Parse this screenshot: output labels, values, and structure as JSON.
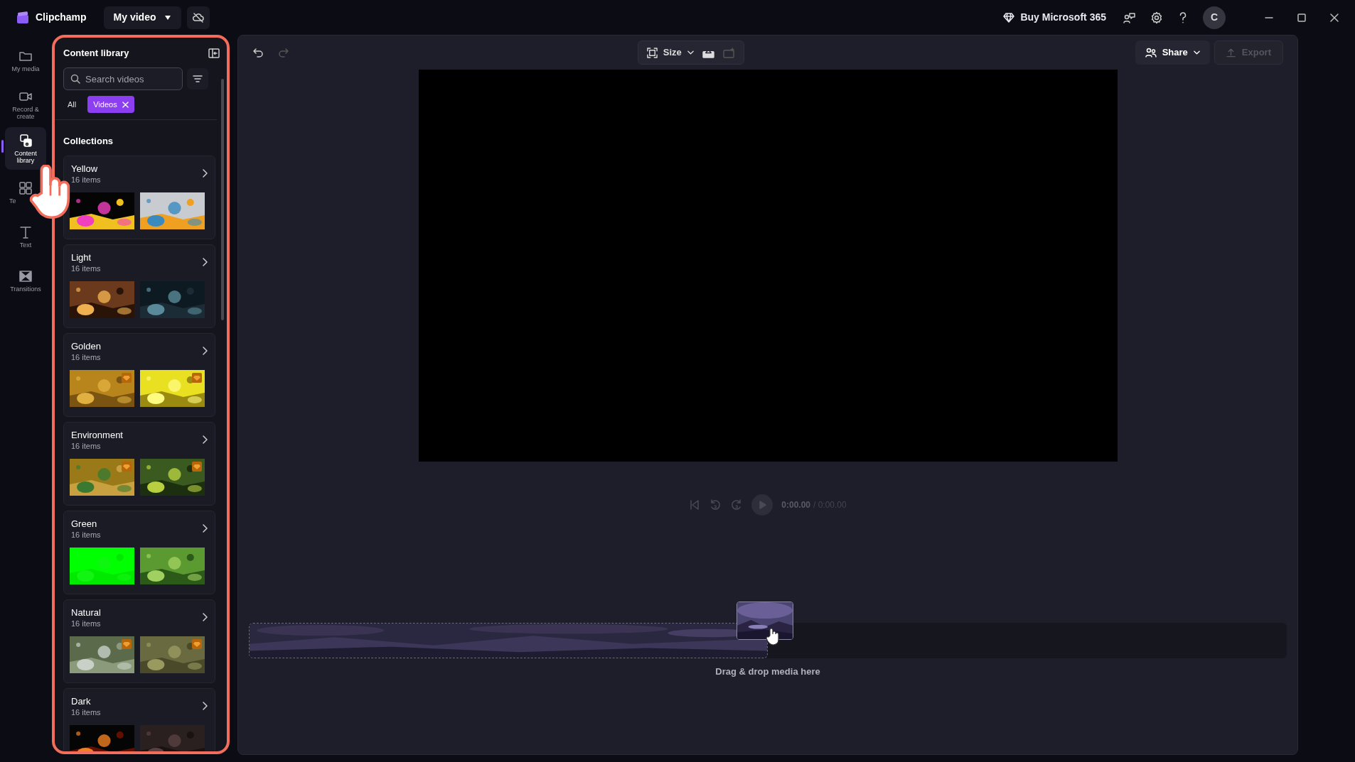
{
  "app": {
    "name": "Clipchamp"
  },
  "project": {
    "title": "My video"
  },
  "top_bar": {
    "promo": "Buy Microsoft 365",
    "avatar": "C"
  },
  "nav": [
    {
      "label": "My media",
      "kind": "folder",
      "selected": false
    },
    {
      "label": "Record & create",
      "kind": "camera",
      "selected": false
    },
    {
      "label": "Content library",
      "kind": "library",
      "selected": true
    },
    {
      "label": "Te",
      "kind": "templates",
      "selected": false
    },
    {
      "label": "Text",
      "kind": "text",
      "selected": false
    },
    {
      "label": "Transitions",
      "kind": "transitions",
      "selected": false
    }
  ],
  "panel": {
    "title": "Content library",
    "search": {
      "placeholder": "Search videos"
    },
    "filters": [
      {
        "label": "All",
        "selected": false
      },
      {
        "label": "Videos",
        "selected": true
      }
    ],
    "section": "Collections",
    "collections": [
      {
        "name": "Yellow",
        "count": "16 items",
        "thumbnails": [
          {
            "kind": "picture",
            "premium": false
          },
          {
            "kind": "picture",
            "premium": false
          }
        ]
      },
      {
        "name": "Light",
        "count": "16 items",
        "thumbnails": [
          {
            "kind": "picture",
            "premium": false
          },
          {
            "kind": "picture",
            "premium": false
          }
        ]
      },
      {
        "name": "Golden",
        "count": "16 items",
        "thumbnails": [
          {
            "kind": "picture",
            "premium": true
          },
          {
            "kind": "picture",
            "premium": true
          }
        ]
      },
      {
        "name": "Environment",
        "count": "16 items",
        "thumbnails": [
          {
            "kind": "picture",
            "premium": true
          },
          {
            "kind": "picture",
            "premium": true
          }
        ]
      },
      {
        "name": "Green",
        "count": "16 items",
        "thumbnails": [
          {
            "kind": "picture",
            "premium": false
          },
          {
            "kind": "picture",
            "premium": false
          }
        ]
      },
      {
        "name": "Natural",
        "count": "16 items",
        "thumbnails": [
          {
            "kind": "picture",
            "premium": true
          },
          {
            "kind": "picture",
            "premium": true
          }
        ]
      },
      {
        "name": "Dark",
        "count": "16 items",
        "thumbnails": [
          {
            "kind": "picture",
            "premium": false
          },
          {
            "kind": "picture",
            "premium": false
          }
        ]
      }
    ]
  },
  "toolbar": {
    "undo": {
      "disabled": false
    },
    "redo": {
      "disabled": true
    },
    "size": "Size",
    "share": "Share",
    "export": {
      "label": "Export",
      "disabled": true
    }
  },
  "player": {
    "time": "0:00.00",
    "duration": "/ 0:00.00"
  },
  "timeline": {
    "hint": "Drag & drop media here"
  }
}
